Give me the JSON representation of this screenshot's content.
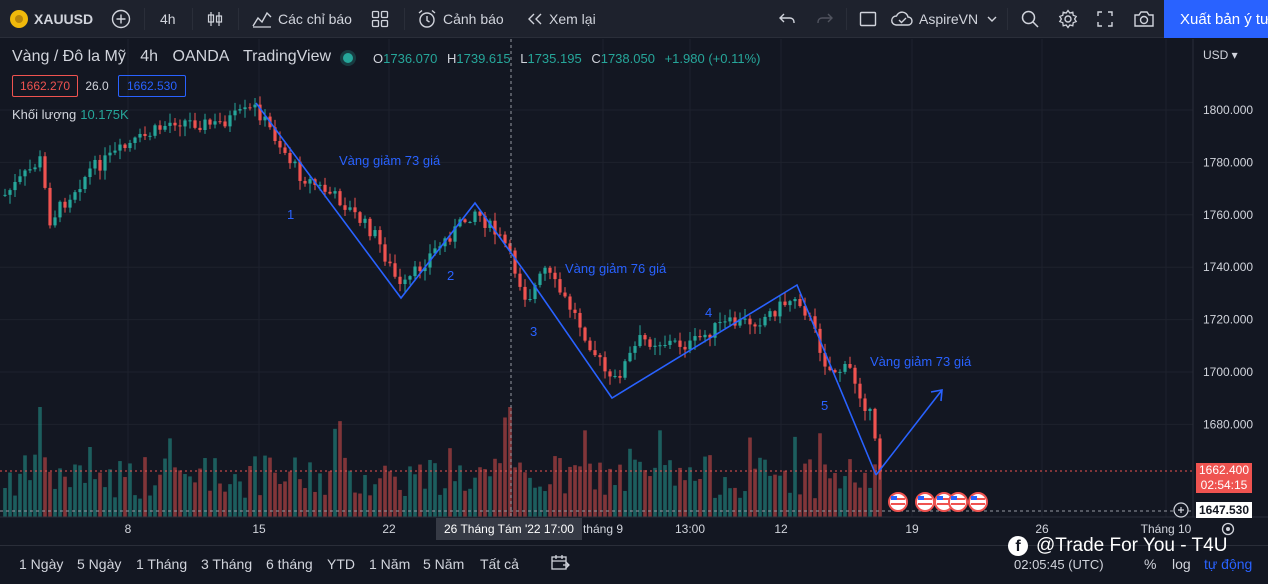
{
  "toolbar": {
    "symbol": "XAUUSD",
    "interval": "4h",
    "indicators": "Các chỉ báo",
    "alert": "Cảnh báo",
    "replay": "Xem lại",
    "account": "AspireVN",
    "publish": "Xuất bản ý tưởng"
  },
  "legend": {
    "title": "Vàng / Đô la Mỹ · 4h · OANDA · TradingView",
    "title_parts": [
      "Vàng / Đô la Mỹ",
      "4h",
      "OANDA",
      "TradingView"
    ],
    "open_label": "O",
    "open": "1736.070",
    "high_label": "H",
    "high": "1739.615",
    "low_label": "L",
    "low": "1735.195",
    "close_label": "C",
    "close": "1738.050",
    "change": "+1.980 (+0.11%)",
    "sell_price": "1662.270",
    "spread": "26.0",
    "buy_price": "1662.530",
    "volume_label": "Khối lượng",
    "volume_value": "10.175K"
  },
  "price_axis": {
    "unit": "USD",
    "ticks": [
      "1800.000",
      "1780.000",
      "1760.000",
      "1740.000",
      "1720.000",
      "1700.000",
      "1680.000"
    ],
    "current_price": "1662.400",
    "countdown": "02:54:15",
    "crosshair_price": "1647.530"
  },
  "time_axis": {
    "ticks": [
      "8",
      "15",
      "22",
      "tháng 9",
      "13:00",
      "12",
      "19",
      "26",
      "Tháng 10"
    ],
    "crosshair_label": "26 Tháng Tám '22    17:00"
  },
  "annotations": {
    "wave1_text": "Vàng giảm 73 giá",
    "wave2_text": "Vàng giảm 76 giá",
    "wave3_text": "Vàng giảm 73 giá",
    "labels": [
      "1",
      "2",
      "3",
      "4",
      "5"
    ]
  },
  "ranges": [
    "1 Ngày",
    "5 Ngày",
    "1 Tháng",
    "3 Tháng",
    "6 tháng",
    "YTD",
    "1 Năm",
    "5 Năm",
    "Tất cả"
  ],
  "status": {
    "time": "02:05:45 (UTC)",
    "percent": "%",
    "log": "log",
    "auto": "tự động"
  },
  "watermark": "@Trade For You - T4U",
  "colors": {
    "up": "#26a69a",
    "down": "#ef5350",
    "drawing": "#2962ff",
    "background": "#131722"
  }
}
